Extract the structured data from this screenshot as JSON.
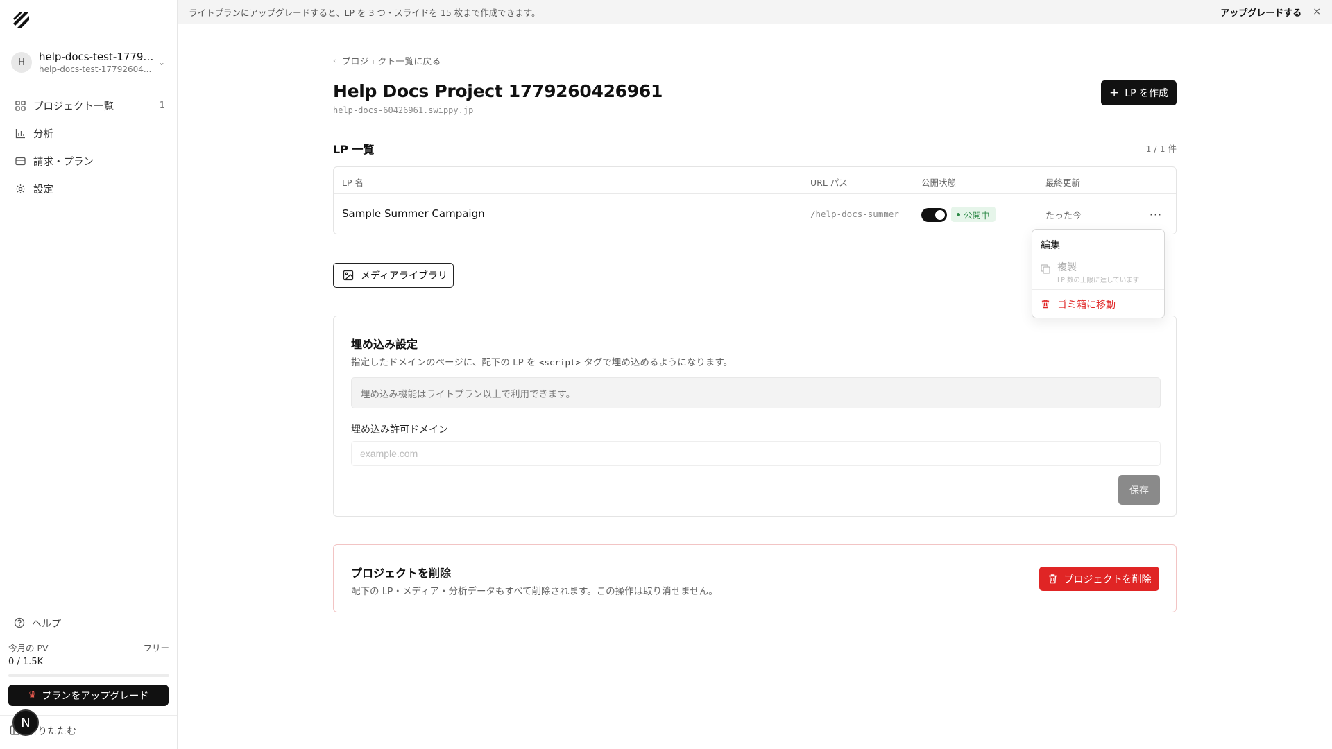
{
  "sidebar": {
    "account": {
      "avatar_letter": "H",
      "name": "help-docs-test-17792...",
      "sub": "help-docs-test-17792604..."
    },
    "nav": [
      {
        "label": "プロジェクト一覧",
        "count": "1",
        "icon": "grid-icon"
      },
      {
        "label": "分析",
        "icon": "bar-chart-icon"
      },
      {
        "label": "請求・プラン",
        "icon": "credit-card-icon"
      },
      {
        "label": "設定",
        "icon": "gear-icon"
      }
    ],
    "help_label": "ヘルプ",
    "pv_label": "今月の PV",
    "plan_label": "フリー",
    "pv_value": "0 / 1.5K",
    "pv_progress": 0,
    "upgrade_label": "プランをアップグレード",
    "collapse_label": "折りたたむ",
    "n_badge": "N"
  },
  "banner": {
    "text": "ライトプランにアップグレードすると、LP を 3 つ・スライドを 15 枚まで作成できます。",
    "link": "アップグレードする",
    "close": "×"
  },
  "main": {
    "back_label": "プロジェクト一覧に戻る",
    "title": "Help Docs Project 1779260426961",
    "domain": "help-docs-60426961.swippy.jp",
    "create_label": "LP を作成",
    "lp_heading": "LP 一覧",
    "lp_count": "1 / 1 件",
    "table": {
      "headers": {
        "name": "LP 名",
        "path": "URL パス",
        "status": "公開状態",
        "updated": "最終更新"
      },
      "rows": [
        {
          "name": "Sample Summer Campaign",
          "path": "/help-docs-summer",
          "published": true,
          "status": "公開中",
          "updated": "たった今"
        }
      ]
    },
    "media_label": "メディアライブラリ",
    "embed": {
      "title": "埋め込み設定",
      "desc_before": "指定したドメインのページに、配下の LP を ",
      "desc_code": "<script>",
      "desc_after": " タグで埋め込めるようになります。",
      "notice": "埋め込み機能はライトプラン以上で利用できます。",
      "domain_label": "埋め込み許可ドメイン",
      "domain_placeholder": "example.com",
      "domain_value": "",
      "save_label": "保存"
    },
    "danger": {
      "title": "プロジェクトを削除",
      "desc": "配下の LP・メディア・分析データもすべて削除されます。この操作は取り消せません。",
      "button": "プロジェクトを削除"
    }
  },
  "menu": {
    "edit": "編集",
    "duplicate": "複製",
    "duplicate_note": "LP 数の上限に達しています",
    "trash": "ゴミ箱に移動"
  },
  "colors": {
    "primary": "#111111",
    "danger": "#e02525",
    "published_bg": "#e6f5ea",
    "published_text": "#2e8a48"
  }
}
